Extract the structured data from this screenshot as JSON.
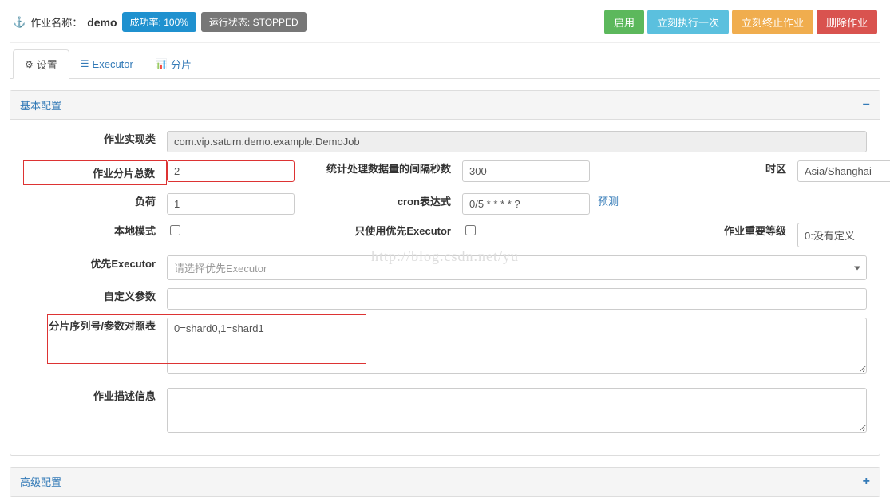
{
  "header": {
    "job_label": "作业名称：",
    "job_name": "demo",
    "success_badge": "成功率: 100%",
    "state_badge": "运行状态: STOPPED",
    "btn_enable": "启用",
    "btn_exec_once": "立刻执行一次",
    "btn_terminate": "立刻终止作业",
    "btn_delete": "删除作业"
  },
  "tabs": {
    "settings": "设置",
    "executor": "Executor",
    "sharding": "分片"
  },
  "basic_panel": {
    "title": "基本配置",
    "impl_class_label": "作业实现类",
    "impl_class_value": "com.vip.saturn.demo.example.DemoJob",
    "shard_total_label": "作业分片总数",
    "shard_total_value": "2",
    "stat_interval_label": "统计处理数据量的间隔秒数",
    "stat_interval_value": "300",
    "timezone_label": "时区",
    "timezone_value": "Asia/Shanghai",
    "load_label": "负荷",
    "load_value": "1",
    "cron_label": "cron表达式",
    "cron_value": "0/5 * * * * ?",
    "predict": "预测",
    "local_mode_label": "本地模式",
    "prefer_only_label": "只使用优先Executor",
    "importance_label": "作业重要等级",
    "importance_value": "0:没有定义",
    "prefer_exec_label": "优先Executor",
    "prefer_exec_placeholder": "请选择优先Executor",
    "custom_param_label": "自定义参数",
    "shard_param_label": "分片序列号/参数对照表",
    "shard_param_value": "0=shard0,1=shard1",
    "desc_label": "作业描述信息"
  },
  "advanced_panel": {
    "title": "高级配置"
  },
  "watermark": "http://blog.csdn.net/yu"
}
